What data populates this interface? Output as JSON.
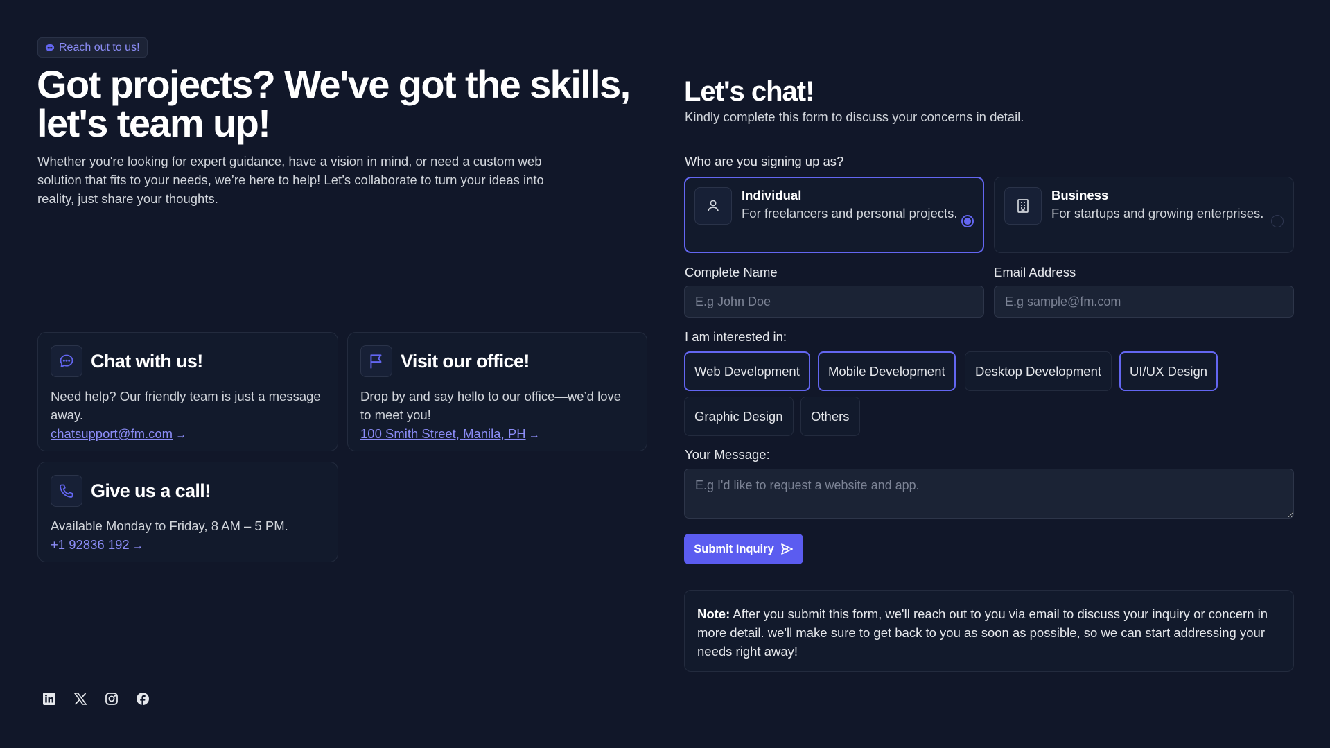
{
  "badge": {
    "label": "Reach out to us!",
    "icon": "chat-bubble-icon"
  },
  "hero": {
    "title": "Got projects? We've got the skills, let's team up!",
    "description": "Whether you're looking for expert guidance, have a vision in mind, or need a custom web solution that fits to your needs, we’re here to help! Let’s collaborate to turn your ideas into reality, just share your thoughts."
  },
  "contact_cards": {
    "chat": {
      "icon": "chat-icon",
      "title": "Chat with us!",
      "text": "Need help? Our friendly team is just a message away.",
      "link": "chatsupport@fm.com",
      "arrow": "→"
    },
    "office": {
      "icon": "flag-icon",
      "title": "Visit our office!",
      "text": "Drop by and say hello to our office—we’d love to meet you!",
      "link": "100 Smith Street, Manila, PH",
      "arrow": "→"
    },
    "call": {
      "icon": "phone-icon",
      "title": "Give us a call!",
      "text": "Available Monday to Friday, 8 AM – 5 PM.",
      "link": "+1 92836 192",
      "arrow": "→"
    }
  },
  "socials": [
    "linkedin-icon",
    "x-icon",
    "instagram-icon",
    "facebook-icon"
  ],
  "form": {
    "title": "Let's chat!",
    "subtitle": "Kindly complete this form to discuss your concerns in detail.",
    "signup_label": "Who are you signing up as?",
    "options": [
      {
        "title": "Individual",
        "desc": "For freelancers and personal projects.",
        "icon": "user-icon",
        "selected": true
      },
      {
        "title": "Business",
        "desc": "For startups and growing enterprises.",
        "icon": "building-icon",
        "selected": false
      }
    ],
    "name_label": "Complete Name",
    "name_placeholder": "E.g John Doe",
    "name_value": "",
    "email_label": "Email Address",
    "email_placeholder": "E.g sample@fm.com",
    "email_value": "",
    "interest_label": "I am interested in:",
    "interests": [
      {
        "label": "Web Development",
        "selected": true
      },
      {
        "label": "Mobile Development",
        "selected": true
      },
      {
        "label": "Desktop Development",
        "selected": false
      },
      {
        "label": "UI/UX Design",
        "selected": true
      },
      {
        "label": "Graphic Design",
        "selected": false
      },
      {
        "label": "Others",
        "selected": false
      }
    ],
    "message_label": "Your Message:",
    "message_placeholder": "E.g I'd like to request a website and app.",
    "message_value": "",
    "submit_label": "Submit Inquiry",
    "submit_icon": "send-icon"
  },
  "note": {
    "prefix": "Note:",
    "text": " After you submit this form, we'll reach out to you via email to discuss your inquiry or concern in more detail. we'll make sure to get back to you as soon as possible, so we can start addressing your needs right away!"
  },
  "colors": {
    "background": "#111729",
    "accent": "#6366f1",
    "link": "#8b8cf6",
    "card": "#121a2c"
  }
}
